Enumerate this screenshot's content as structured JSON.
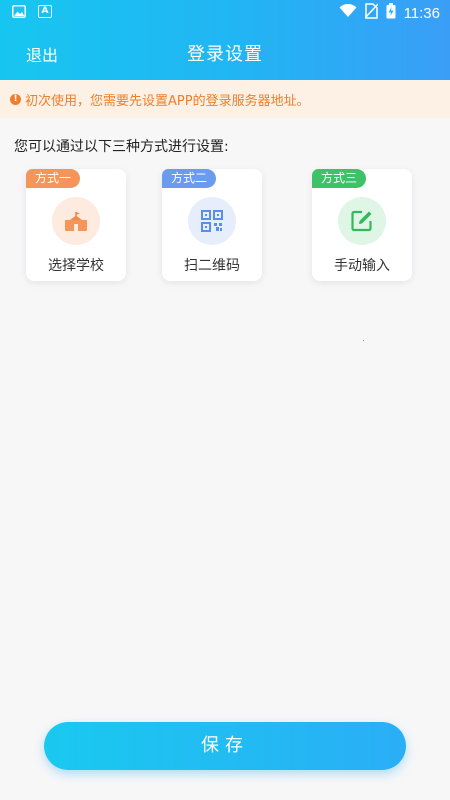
{
  "status_bar": {
    "time": "11:36",
    "icons": [
      "image-icon",
      "a-icon",
      "wifi-icon",
      "no-sim-icon",
      "battery-charging-icon"
    ]
  },
  "nav": {
    "exit_label": "退出",
    "title": "登录设置"
  },
  "notice": {
    "text": "初次使用，您需要先设置APP的登录服务器地址。",
    "color": "#ee7f2a"
  },
  "instruction": "您可以通过以下三种方式进行设置:",
  "methods": [
    {
      "tag": "方式一",
      "label": "选择学校",
      "icon": "school-icon",
      "tag_color": "#f4955a",
      "circle_color": "#fdebe0"
    },
    {
      "tag": "方式二",
      "label": "扫二维码",
      "icon": "qr-code-icon",
      "tag_color": "#6a9bf0",
      "circle_color": "#e6eefc"
    },
    {
      "tag": "方式三",
      "label": "手动输入",
      "icon": "edit-icon",
      "tag_color": "#3ec267",
      "circle_color": "#dff5e5"
    }
  ],
  "save_label": "保存",
  "accent": "#22b4f4"
}
